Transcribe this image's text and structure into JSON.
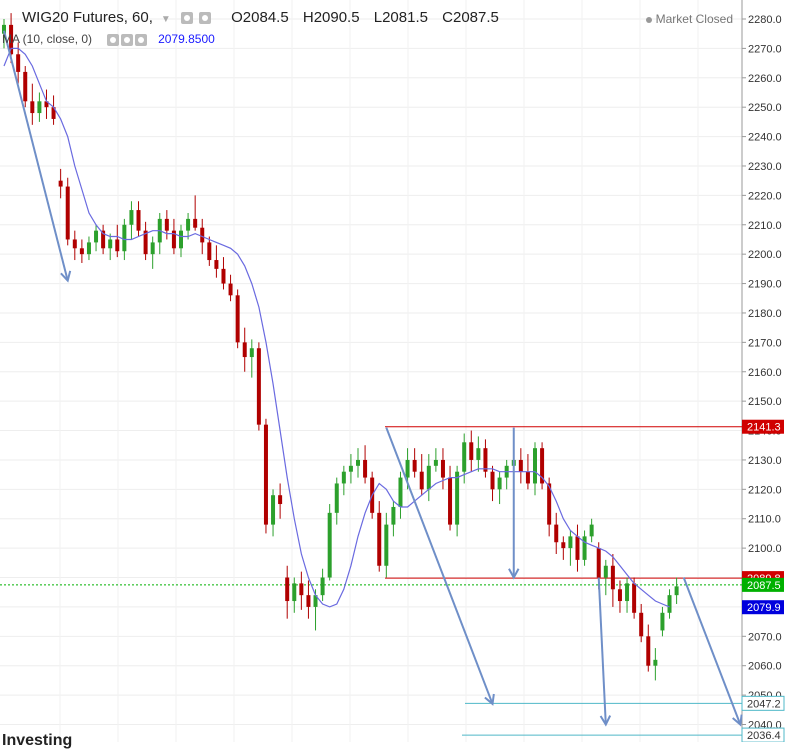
{
  "header": {
    "symbol": "WIG20 Futures, 60,",
    "open": "O2084.5",
    "high": "H2090.5",
    "low": "L2081.5",
    "close": "C2087.5",
    "status": "Market Closed"
  },
  "indicator": {
    "label": "MA (10, close, 0)",
    "value": "2079.8500"
  },
  "logo": "Investing",
  "colors": {
    "up": "#2ca02c",
    "down": "#b00000",
    "ma": "#6a6ae0",
    "resistance": "#d00000",
    "target": "#4fb8c8",
    "arrow": "#6f8fc8",
    "last_price": "#00b000",
    "ma_badge": "#0000dd"
  },
  "chart_data": {
    "type": "candlestick",
    "yaxis": {
      "range": [
        2036,
        2283
      ],
      "ticks": [
        "2280.0",
        "2270.0",
        "2260.0",
        "2250.0",
        "2240.0",
        "2230.0",
        "2220.0",
        "2210.0",
        "2200.0",
        "2190.0",
        "2180.0",
        "2170.0",
        "2160.0",
        "2150.0",
        "2140.0",
        "2130.0",
        "2120.0",
        "2110.0",
        "2100.0",
        "2090.0",
        "2080.0",
        "2070.0",
        "2060.0",
        "2050.0",
        "2040.0"
      ]
    },
    "candles": [
      [
        2275,
        2280,
        2270,
        2278
      ],
      [
        2278,
        2282,
        2265,
        2268
      ],
      [
        2268,
        2272,
        2258,
        2262
      ],
      [
        2262,
        2264,
        2250,
        2252
      ],
      [
        2252,
        2258,
        2244,
        2248
      ],
      [
        2248,
        2255,
        2245,
        2252
      ],
      [
        2252,
        2256,
        2246,
        2250
      ],
      [
        2250,
        2254,
        2244,
        2246
      ],
      [
        2225,
        2229,
        2219,
        2223
      ],
      [
        2223,
        2226,
        2203,
        2205
      ],
      [
        2205,
        2208,
        2198,
        2202
      ],
      [
        2202,
        2205,
        2197,
        2200
      ],
      [
        2200,
        2206,
        2198,
        2204
      ],
      [
        2204,
        2210,
        2201,
        2208
      ],
      [
        2208,
        2210,
        2200,
        2202
      ],
      [
        2202,
        2207,
        2198,
        2205
      ],
      [
        2205,
        2210,
        2199,
        2201
      ],
      [
        2201,
        2212,
        2198,
        2210
      ],
      [
        2210,
        2218,
        2205,
        2215
      ],
      [
        2215,
        2218,
        2206,
        2208
      ],
      [
        2208,
        2211,
        2198,
        2200
      ],
      [
        2200,
        2206,
        2195,
        2204
      ],
      [
        2204,
        2214,
        2200,
        2212
      ],
      [
        2212,
        2215,
        2205,
        2208
      ],
      [
        2208,
        2212,
        2200,
        2202
      ],
      [
        2202,
        2210,
        2199,
        2208
      ],
      [
        2208,
        2214,
        2205,
        2212
      ],
      [
        2212,
        2220,
        2208,
        2209
      ],
      [
        2209,
        2212,
        2200,
        2204
      ],
      [
        2204,
        2206,
        2196,
        2198
      ],
      [
        2198,
        2203,
        2192,
        2195
      ],
      [
        2195,
        2199,
        2188,
        2190
      ],
      [
        2190,
        2193,
        2184,
        2186
      ],
      [
        2186,
        2188,
        2168,
        2170
      ],
      [
        2170,
        2175,
        2160,
        2165
      ],
      [
        2165,
        2171,
        2158,
        2168
      ],
      [
        2168,
        2170,
        2140,
        2142
      ],
      [
        2142,
        2144,
        2105,
        2108
      ],
      [
        2108,
        2120,
        2104,
        2118
      ],
      [
        2118,
        2122,
        2110,
        2115
      ],
      [
        2090,
        2094,
        2076,
        2082
      ],
      [
        2082,
        2090,
        2078,
        2088
      ],
      [
        2088,
        2092,
        2079,
        2084
      ],
      [
        2084,
        2089,
        2076,
        2080
      ],
      [
        2080,
        2086,
        2072,
        2084
      ],
      [
        2084,
        2093,
        2082,
        2090
      ],
      [
        2090,
        2115,
        2089,
        2112
      ],
      [
        2112,
        2124,
        2108,
        2122
      ],
      [
        2122,
        2128,
        2118,
        2126
      ],
      [
        2126,
        2132,
        2122,
        2128
      ],
      [
        2128,
        2134,
        2124,
        2130
      ],
      [
        2130,
        2135,
        2122,
        2124
      ],
      [
        2124,
        2126,
        2110,
        2112
      ],
      [
        2112,
        2116,
        2092,
        2094
      ],
      [
        2094,
        2112,
        2090,
        2108
      ],
      [
        2108,
        2116,
        2104,
        2114
      ],
      [
        2114,
        2126,
        2110,
        2124
      ],
      [
        2124,
        2134,
        2120,
        2130
      ],
      [
        2130,
        2134,
        2124,
        2126
      ],
      [
        2126,
        2132,
        2118,
        2120
      ],
      [
        2120,
        2132,
        2116,
        2128
      ],
      [
        2128,
        2134,
        2126,
        2130
      ],
      [
        2130,
        2134,
        2120,
        2124
      ],
      [
        2124,
        2128,
        2106,
        2108
      ],
      [
        2108,
        2128,
        2104,
        2126
      ],
      [
        2126,
        2139,
        2122,
        2136
      ],
      [
        2136,
        2140,
        2126,
        2130
      ],
      [
        2130,
        2138,
        2126,
        2134
      ],
      [
        2134,
        2137,
        2124,
        2126
      ],
      [
        2126,
        2128,
        2116,
        2120
      ],
      [
        2120,
        2126,
        2115,
        2124
      ],
      [
        2124,
        2130,
        2120,
        2128
      ],
      [
        2128,
        2134,
        2124,
        2130
      ],
      [
        2130,
        2134,
        2122,
        2126
      ],
      [
        2126,
        2132,
        2120,
        2122
      ],
      [
        2122,
        2136,
        2118,
        2134
      ],
      [
        2134,
        2136,
        2120,
        2122
      ],
      [
        2122,
        2124,
        2104,
        2108
      ],
      [
        2108,
        2112,
        2098,
        2102
      ],
      [
        2102,
        2104,
        2096,
        2100
      ],
      [
        2100,
        2106,
        2094,
        2104
      ],
      [
        2104,
        2108,
        2092,
        2096
      ],
      [
        2096,
        2106,
        2094,
        2104
      ],
      [
        2104,
        2110,
        2102,
        2108
      ],
      [
        2100,
        2102,
        2086,
        2090
      ],
      [
        2090,
        2096,
        2084,
        2094
      ],
      [
        2094,
        2098,
        2080,
        2086
      ],
      [
        2086,
        2089,
        2078,
        2082
      ],
      [
        2082,
        2090,
        2078,
        2088
      ],
      [
        2088,
        2090,
        2076,
        2078
      ],
      [
        2078,
        2081,
        2068,
        2070
      ],
      [
        2070,
        2074,
        2058,
        2060
      ],
      [
        2060,
        2066,
        2055,
        2062
      ],
      [
        2072,
        2080,
        2070,
        2078
      ],
      [
        2078,
        2086,
        2076,
        2084
      ],
      [
        2084,
        2090,
        2081,
        2087
      ]
    ],
    "moving_average": [
      2264,
      2270,
      2270,
      2268,
      2264,
      2258,
      2252,
      2250,
      2246,
      2240,
      2230,
      2222,
      2214,
      2210,
      2207,
      2206,
      2206,
      2205,
      2205,
      2206,
      2207,
      2208,
      2208,
      2207,
      2207,
      2206,
      2206,
      2207,
      2206,
      2205,
      2204,
      2203,
      2202,
      2200,
      2196,
      2190,
      2182,
      2170,
      2156,
      2140,
      2124,
      2110,
      2098,
      2090,
      2084,
      2081,
      2080,
      2081,
      2086,
      2094,
      2104,
      2112,
      2118,
      2122,
      2120,
      2116,
      2114,
      2114,
      2116,
      2118,
      2120,
      2122,
      2123,
      2124,
      2124,
      2125,
      2126,
      2127,
      2127,
      2127,
      2126,
      2126,
      2126,
      2126,
      2126,
      2126,
      2124,
      2121,
      2116,
      2110,
      2106,
      2104,
      2102,
      2101,
      2100,
      2099,
      2097,
      2094,
      2091,
      2088,
      2086,
      2084,
      2082,
      2081,
      2080
    ],
    "levels": [
      {
        "label": "2141.3",
        "value": 2141.3,
        "kind": "resistance"
      },
      {
        "label": "2089.8",
        "value": 2089.8,
        "kind": "support"
      },
      {
        "label": "2047.2",
        "value": 2047.2,
        "kind": "target"
      },
      {
        "label": "2036.4",
        "value": 2036.4,
        "kind": "target"
      }
    ],
    "last_price": {
      "label": "2087.5",
      "value": 2087.5
    },
    "ma_value": {
      "label": "2079.9",
      "value": 2079.9
    },
    "arrows": [
      {
        "from_bar": 0,
        "from_price": 2276,
        "to_bar": 9,
        "to_price": 2191
      },
      {
        "from_bar": 54,
        "from_price": 2141,
        "to_bar": 69,
        "to_price": 2047
      },
      {
        "from_bar": 72,
        "from_price": 2141,
        "to_bar": 72,
        "to_price": 2090
      },
      {
        "from_bar": 84,
        "from_price": 2090,
        "to_bar": 85,
        "to_price": 2040
      },
      {
        "from_bar": 96,
        "from_price": 2090,
        "to_bar": 104,
        "to_price": 2040
      }
    ]
  }
}
